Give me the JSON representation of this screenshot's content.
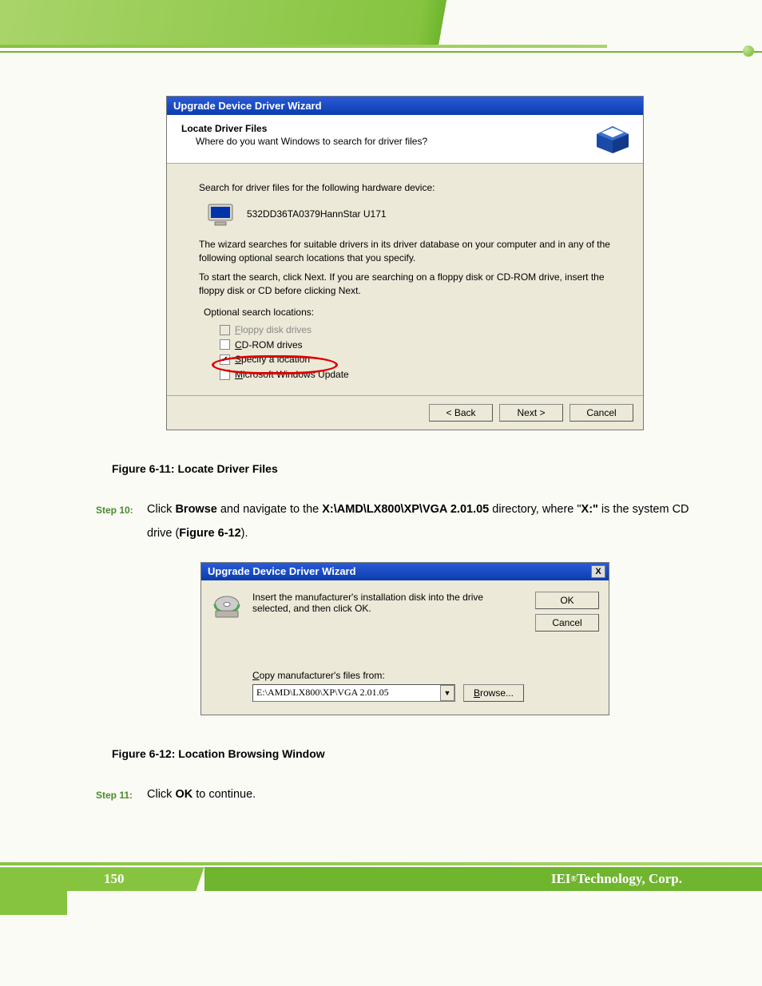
{
  "dialog1": {
    "title": "Upgrade Device Driver Wizard",
    "heading": "Locate Driver Files",
    "subheading": "Where do you want Windows to search for driver files?",
    "search_line": "Search for driver files for the following hardware device:",
    "device_name": "532DD36TA0379HannStar U171",
    "desc1": "The wizard searches for suitable drivers in its driver database on your computer and in any of the following optional search locations that you specify.",
    "desc2": "To start the search, click Next. If you are searching on a floppy disk or CD-ROM drive, insert the floppy disk or CD before clicking Next.",
    "opt_label": "Optional search locations:",
    "checks": {
      "floppy": "Floppy disk drives",
      "cdrom": "CD-ROM drives",
      "specify": "Specify a location",
      "msupdate": "Microsoft Windows Update"
    },
    "btn_back": "< Back",
    "btn_next": "Next >",
    "btn_cancel": "Cancel"
  },
  "caption1": "Figure 6-11: Locate Driver Files",
  "step10": {
    "label": "Step 10:",
    "pre": "Click ",
    "browse": "Browse",
    "mid": " and navigate to the ",
    "path": "X:\\AMD\\LX800\\XP\\VGA 2.01.05",
    "post1": " directory, where \"",
    "x": "X:\"",
    "post2": " is the system CD drive (",
    "figref": "Figure 6-12",
    "post3": ")."
  },
  "dialog2": {
    "title": "Upgrade Device Driver Wizard",
    "close": "X",
    "instr": "Insert the manufacturer's installation disk into the drive selected, and then click OK.",
    "ok": "OK",
    "cancel": "Cancel",
    "copy_label": "Copy manufacturer's files from:",
    "path_value": "E:\\AMD\\LX800\\XP\\VGA 2.01.05",
    "browse": "Browse..."
  },
  "caption2": "Figure 6-12: Location Browsing Window",
  "step11": {
    "label": "Step 11:",
    "pre": "Click ",
    "ok": "OK",
    "post": " to continue."
  },
  "footer": {
    "page": "150",
    "corp_pre": "IEI",
    "corp_reg": "®",
    "corp_post": " Technology, Corp."
  }
}
